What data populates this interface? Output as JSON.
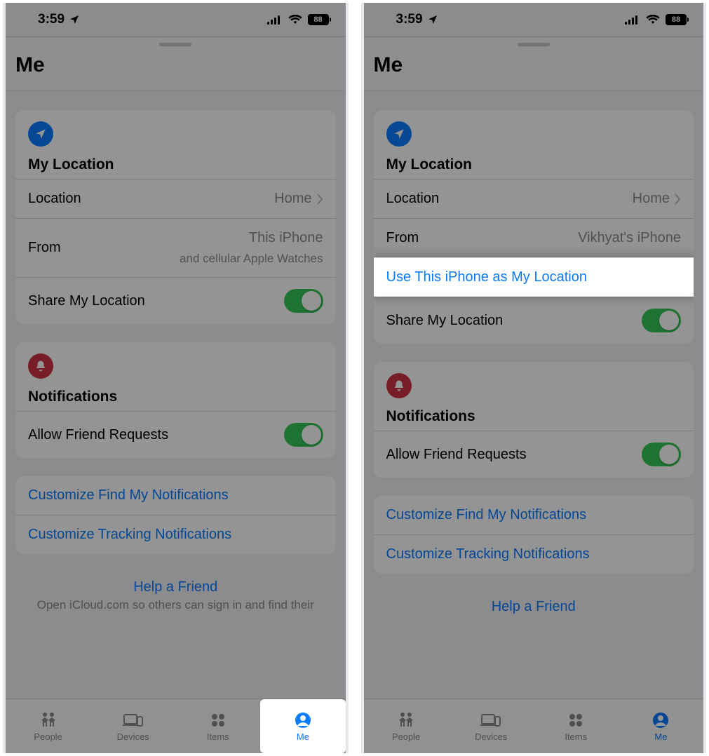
{
  "status": {
    "time": "3:59",
    "battery": "88"
  },
  "sheet": {
    "title": "Me"
  },
  "location_section": {
    "title": "My Location",
    "location_label": "Location",
    "location_value": "Home",
    "from_label": "From",
    "share_label": "Share My Location"
  },
  "left": {
    "from_value": "This iPhone",
    "from_sub": "and cellular Apple Watches"
  },
  "right": {
    "from_value": "Vikhyat's iPhone",
    "use_this": "Use This iPhone as My Location"
  },
  "notifications_section": {
    "title": "Notifications",
    "allow_label": "Allow Friend Requests",
    "customize_findmy": "Customize Find My Notifications",
    "customize_tracking": "Customize Tracking Notifications"
  },
  "help": {
    "title": "Help a Friend",
    "sub": "Open iCloud.com so others can sign in and find their"
  },
  "tabs": {
    "people": "People",
    "devices": "Devices",
    "items": "Items",
    "me": "Me"
  }
}
